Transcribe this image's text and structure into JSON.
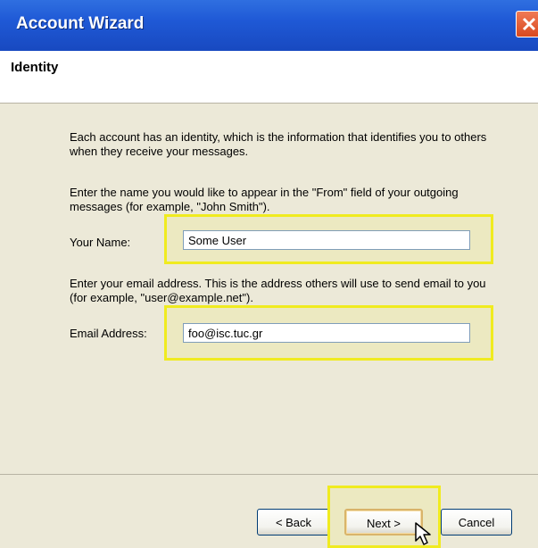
{
  "window": {
    "title": "Account Wizard",
    "close_icon": "close-x-icon",
    "titlebar_color": "#1f59d6",
    "close_color": "#d8491f"
  },
  "header": {
    "title": "Identity"
  },
  "body": {
    "intro": "Each account has an identity, which is the information that identifies you to others when they receive your messages.",
    "name_instruction": "Enter the name you would like to appear in the \"From\" field of your outgoing messages (for example, \"John Smith\").",
    "name_label": "Your Name:",
    "name_value": "Some User",
    "email_instruction": "Enter your email address. This is the address others will use to send email to you (for example, \"user@example.net\").",
    "email_label": "Email Address:",
    "email_value": "foo@isc.tuc.gr",
    "highlight_color": "#f0eb1f"
  },
  "buttons": {
    "back": "< Back",
    "next": "Next >",
    "cancel": "Cancel"
  },
  "cursor_icon": "mouse-pointer-icon"
}
